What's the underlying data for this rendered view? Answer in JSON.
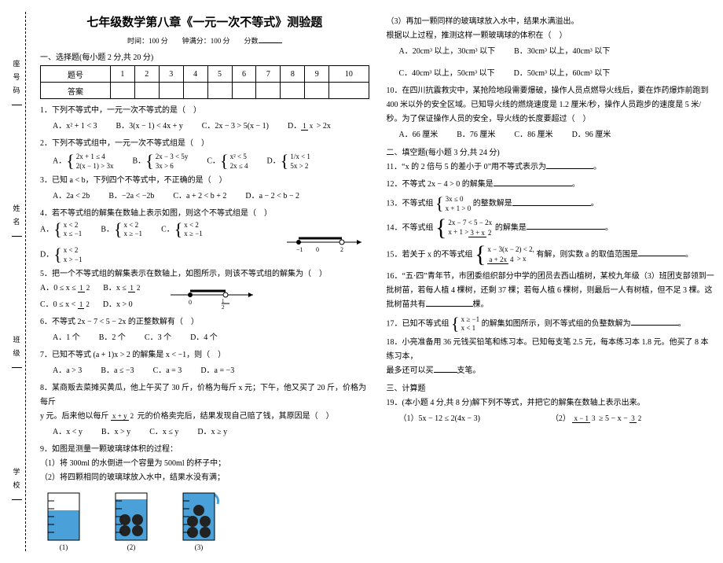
{
  "binding": {
    "school": "学校",
    "class": "班级",
    "name": "姓名",
    "seat": "座号码"
  },
  "title": "七年级数学第八章《一元一次不等式》测验题",
  "timeline": "时间：100 分　　钟满分：100 分　　分数",
  "section1_head": "一、选择题(每小题 2 分,共 20 分)",
  "grid": {
    "hdr": "题号",
    "ans": "答案",
    "cols": [
      "1",
      "2",
      "3",
      "4",
      "5",
      "6",
      "7",
      "8",
      "9",
      "10"
    ]
  },
  "q1": {
    "stem": "1．下列不等式中，一元一次不等式的是（　）",
    "A": "A．x² + 1 < 3",
    "B": "B．3(x − 1) < 4x + y",
    "C": "C．2x − 3 > 5(x − 1)",
    "D": "D．1/x > 2x",
    "D_num": "1",
    "D_den": "x"
  },
  "q2": {
    "stem": "2．下列不等式组中，一元一次不等式组是（　）",
    "A_r1": "2x + 1 ≤ 4",
    "A_r2": "2(x − 1) > 3x",
    "B_r1": "2x − 3 < 5y",
    "B_r2": "3x > 6",
    "C_r1": "x² < 5",
    "C_r2": "2x ≤ 4",
    "D_r1": "1/x < 1",
    "D_r2": "5x > 2"
  },
  "q3": {
    "stem": "3．已知 a < b，下列四个不等式中，不正确的是（　）",
    "A": "A．2a < 2b",
    "B": "B．−2a < −2b",
    "C": "C．a + 2 < b + 2",
    "D": "D．a − 2 < b − 2"
  },
  "q4": {
    "stem": "4．若不等式组的解集在数轴上表示如图，则这个不等式组是（　）",
    "A_r1": "x < 2",
    "A_r2": "x ≤ −1",
    "B_r1": "x < 2",
    "B_r2": "x ≥ −1",
    "C_r1": "x < 2",
    "C_r2": "x ≥ −1",
    "D_r1": "x < 2",
    "D_r2": "x > −1",
    "axis_a": "−1",
    "axis_b": "0",
    "axis_c": "2"
  },
  "q5": {
    "stem": "5．把一个不等式组的解集表示在数轴上，如图所示，则该不等式组的解集为（　）",
    "A_pre": "A．0 ≤ x ≤",
    "A_num": "1",
    "A_den": "2",
    "B_pre": "B．x ≤",
    "B_num": "1",
    "B_den": "2",
    "C_pre": "C．0 ≤ x <",
    "C_num": "1",
    "C_den": "2",
    "D": "D．x > 0",
    "axis_a": "0",
    "axis_num": "1",
    "axis_den": "2"
  },
  "q6": {
    "stem": "6．不等式 2x − 7 < 5 − 2x 的正整数解有（　）",
    "A": "A．1 个",
    "B": "B．2 个",
    "C": "C．3 个",
    "D": "D．4 个"
  },
  "q7": {
    "stem": "7．已知不等式 (a + 1)x > 2 的解集是 x < −1，则（　）",
    "A": "A．a > 3",
    "B": "B．a ≤ −3",
    "C": "C．a = 3",
    "D": "D．a = −3"
  },
  "q8": {
    "stem": "8．某商贩去菜摊买黄瓜，他上午买了 30 斤，价格为每斤 x 元；下午，他又买了 20 斤，价格为每斤",
    "stem2_pre": "y 元。后来他以每斤",
    "stem2_num": "x + y",
    "stem2_den": "2",
    "stem2_post": "元的价格卖完后，结果发现自己赔了钱，其原因是（　）",
    "A": "A．x < y",
    "B": "B．x > y",
    "C": "C．x ≤ y",
    "D": "D．x ≥ y"
  },
  "q9": {
    "stem": "9．如图是测量一颗玻璃球体积的过程：",
    "s1": "（1）将 300ml 的水倒进一个容量为 500ml 的杯子中；",
    "s2": "（2）将四颗相同的玻璃球放入水中，结果水没有满；"
  },
  "q9c": {
    "s3": "（3）再加一颗同样的玻璃球放入水中，结果水满溢出。",
    "foot": "根据以上过程，推测这样一颗玻璃球的体积在（　）",
    "A": "A．20cm³ 以上，30cm³ 以下",
    "B": "B．30cm³ 以上，40cm³ 以下",
    "C": "C．40cm³ 以上，50cm³ 以下",
    "D": "D．50cm³ 以上，60cm³ 以下"
  },
  "q10": {
    "stem": "10．在四川抗震救灾中，某抢险地段需要爆破，操作人员点燃导火线后，要在炸药爆炸前跑到 400 米以外的安全区域。已知导火线的燃烧速度是 1.2 厘米/秒，操作人员跑步的速度是 5 米/秒。为了保证操作人员的安全，导火线的长度要超过（　）",
    "A": "A．66 厘米",
    "B": "B．76 厘米",
    "C": "C．86 厘米",
    "D": "D．96 厘米"
  },
  "section2_head": "二、填空题(每小题 3 分,共 24 分)",
  "q11": "11．“x 的 2 倍与 5 的差小于 0”用不等式表示为",
  "q12": "12．不等式 2x − 4 > 0 的解集是",
  "q13": {
    "pre": "13．不等式组",
    "r1": "3x ≤ 0",
    "r2": "x + 1 > 0",
    "post": "的整数解是"
  },
  "q14": {
    "pre": "14．不等式组",
    "r1": "2x − 7 < 5 − 2x",
    "r2_pre": "x + 1 >",
    "r2_num": "3 + x",
    "r2_den": "2",
    "post": "的解集是"
  },
  "q15": {
    "pre": "15．若关于 x 的不等式组",
    "r1": "x − 3(x − 2) < 2,",
    "r2_num": "a + 2x",
    "r2_den": "4",
    "r2_post": " > x",
    "post": "有解，则实数 a 的取值范围是"
  },
  "q16": {
    "text": "16．“五·四”青年节，市团委组织部分中学的团员去西山植树，某校九年级（3）班团支部领到一批树苗，若每人植 4 棵树，还剩 37 棵；若每人植 6 棵树，则最后一人有树植，但不足 3 棵。这批树苗共有",
    "tail": "棵。"
  },
  "q17": {
    "pre": "17．已知不等式组",
    "r1": "x ≥ −1",
    "r2": "x < 1",
    "post": "的解集如图所示，则不等式组的负整数解为"
  },
  "q18": {
    "l1": "18．小亮准备用 36 元钱买铅笔和练习本。已知每支笔 2.5 元，每本练习本 1.8 元。他买了 8 本练习本，",
    "l2_pre": "最多还可以买",
    "l2_post": "支笔。"
  },
  "section3_head": "三、计算题",
  "q19": {
    "stem": "19．(本小题 4 分,共 8 分)解下列不等式，并把它的解集在数轴上表示出来。",
    "p1": "（1）5x − 12 ≤ 2(4x − 3)",
    "p2_pre": "（2）",
    "p2_num": "x − 1",
    "p2_den": "3",
    "p2_mid": " ≥ 5 − x −",
    "p2_num2": "3",
    "p2_den2": "2"
  },
  "beakers": {
    "c1": "(1)",
    "c2": "(2)",
    "c3": "(3)"
  }
}
